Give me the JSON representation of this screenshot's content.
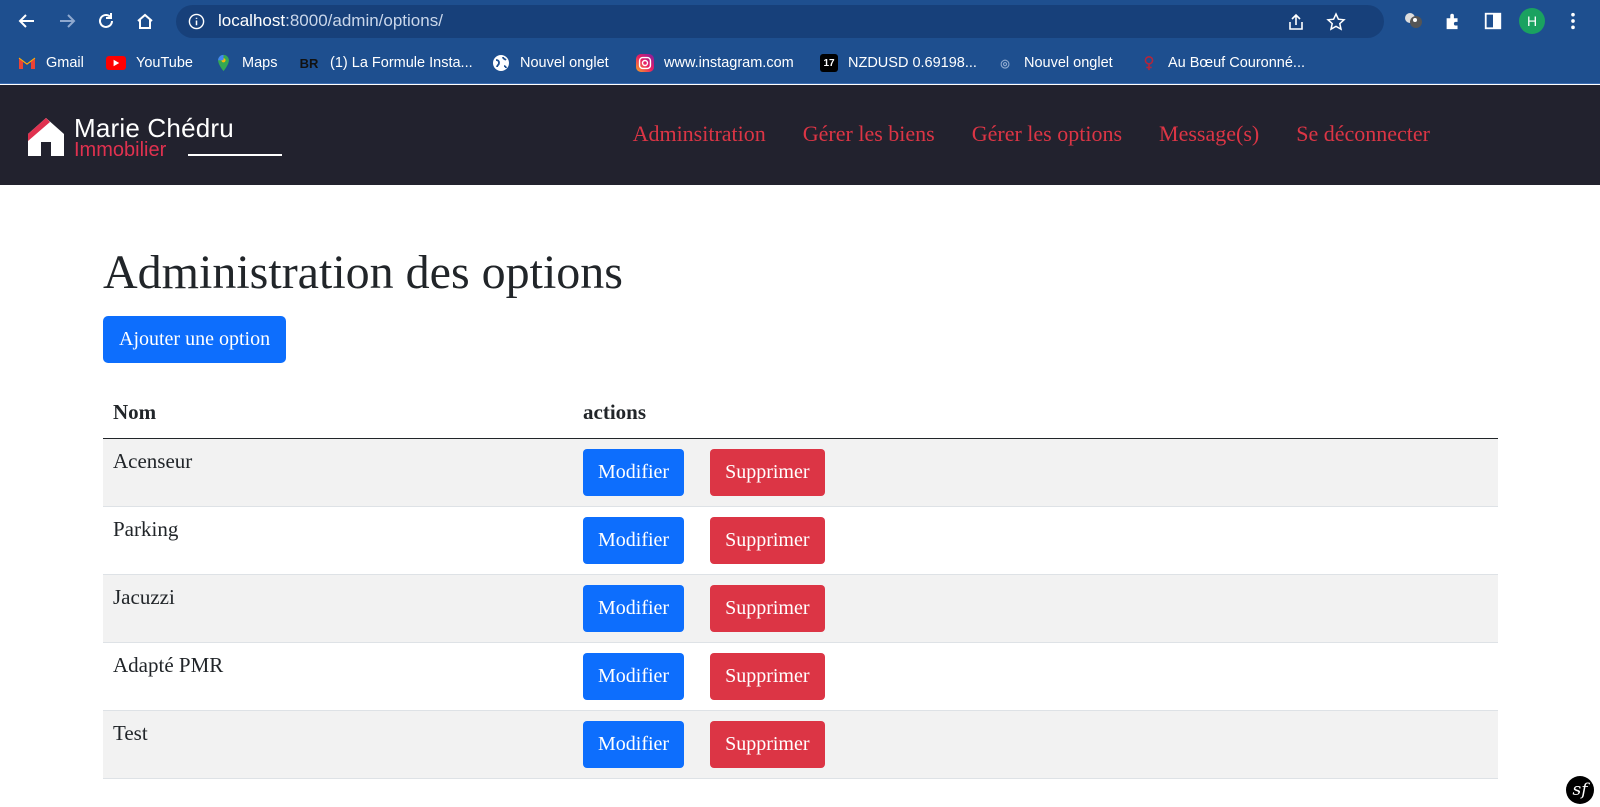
{
  "browser": {
    "url_host": "localhost",
    "url_path": ":8000/admin/options/",
    "profile_initial": "H",
    "bookmarks": [
      {
        "label": "Gmail",
        "icon": "gmail-icon"
      },
      {
        "label": "YouTube",
        "icon": "youtube-icon"
      },
      {
        "label": "Maps",
        "icon": "maps-icon"
      },
      {
        "label": "(1) La Formule Insta...",
        "icon": "br-icon"
      },
      {
        "label": "Nouvel onglet",
        "icon": "globe-icon"
      },
      {
        "label": "www.instagram.com",
        "icon": "instagram-icon"
      },
      {
        "label": "NZDUSD 0.69198...",
        "icon": "tradingview-icon"
      },
      {
        "label": "Nouvel onglet",
        "icon": "generic-page-icon"
      },
      {
        "label": "Au Bœuf Couronné...",
        "icon": "restaurant-icon"
      }
    ]
  },
  "site": {
    "logo_name": "Marie Chédru",
    "logo_sub": "Immobilier",
    "nav": [
      "Adminsitration",
      "Gérer les biens",
      "Gérer les options",
      "Message(s)",
      "Se déconnecter"
    ]
  },
  "main": {
    "title": "Administration des options",
    "add_button": "Ajouter une option",
    "table": {
      "headers": [
        "Nom",
        "actions"
      ],
      "edit_label": "Modifier",
      "delete_label": "Supprimer",
      "rows": [
        "Acenseur",
        "Parking",
        "Jacuzzi",
        "Adapté PMR",
        "Test"
      ]
    }
  },
  "colors": {
    "primary": "#0d6efd",
    "danger": "#dc3545",
    "header_bg": "#22222e",
    "browser_bg": "#1e4f8f"
  },
  "debug_badge": "sf"
}
